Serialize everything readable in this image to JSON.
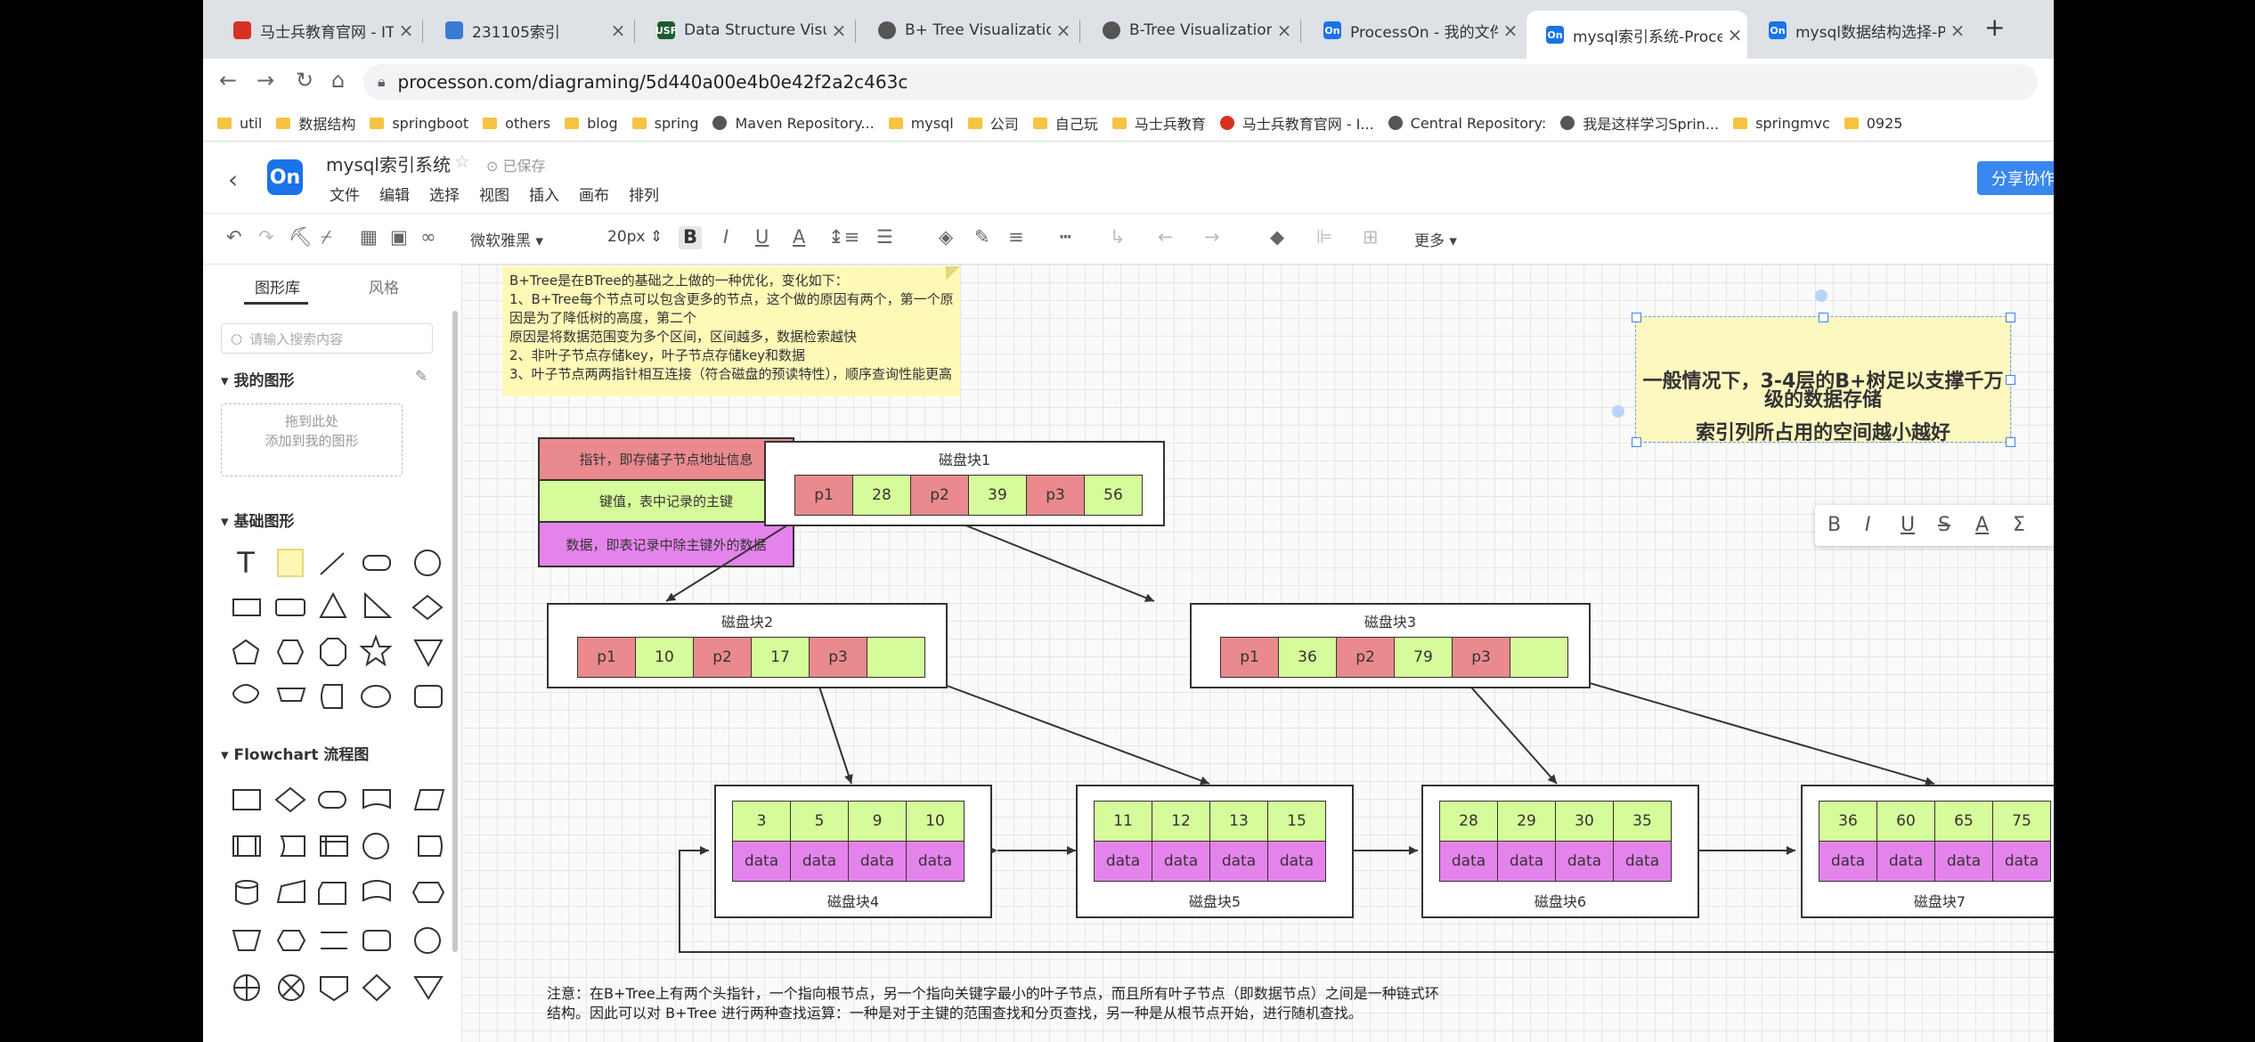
{
  "tabs": [
    {
      "title": "马士兵教育官网 - IT职",
      "icon": "msb-icon",
      "color": "#d93025"
    },
    {
      "title": "231105索引",
      "icon": "doc-icon",
      "color": "#3a7bd5"
    },
    {
      "title": "Data Structure Visual",
      "icon": "usf-icon",
      "color": "#1e5b2e"
    },
    {
      "title": "B+ Tree Visualization",
      "icon": "globe-icon",
      "color": "#555"
    },
    {
      "title": "B-Tree Visualization",
      "icon": "globe-icon",
      "color": "#555"
    },
    {
      "title": "ProcessOn - 我的文件",
      "icon": "processon-icon",
      "color": "#1a73e8"
    },
    {
      "title": "mysql索引系统-Proce",
      "icon": "processon-icon",
      "color": "#1a73e8",
      "active": true
    },
    {
      "title": "mysql数据结构选择-P",
      "icon": "processon-icon",
      "color": "#1a73e8"
    }
  ],
  "url": "processon.com/diagraming/5d440a00e4b0e42f2a2c463c",
  "bookmarks": [
    {
      "label": "util",
      "type": "folder"
    },
    {
      "label": "数据结构",
      "type": "folder"
    },
    {
      "label": "springboot",
      "type": "folder"
    },
    {
      "label": "others",
      "type": "folder"
    },
    {
      "label": "blog",
      "type": "folder"
    },
    {
      "label": "spring",
      "type": "folder"
    },
    {
      "label": "Maven Repository...",
      "type": "site"
    },
    {
      "label": "mysql",
      "type": "folder"
    },
    {
      "label": "公司",
      "type": "folder"
    },
    {
      "label": "自己玩",
      "type": "folder"
    },
    {
      "label": "马士兵教育",
      "type": "folder"
    },
    {
      "label": "马士兵教育官网 - I...",
      "type": "red"
    },
    {
      "label": "Central Repository:",
      "type": "site"
    },
    {
      "label": "我是这样学习Sprin...",
      "type": "site"
    },
    {
      "label": "springmvc",
      "type": "folder"
    },
    {
      "label": "0925",
      "type": "folder"
    }
  ],
  "app": {
    "logo": "On",
    "doc_title": "mysql索引系统",
    "saved": "已保存",
    "menu": [
      "文件",
      "编辑",
      "选择",
      "视图",
      "插入",
      "画布",
      "排列"
    ],
    "share": "分享协作"
  },
  "toolbar": {
    "font": "微软雅黑",
    "size": "20px",
    "more": "更多"
  },
  "sidebar": {
    "tab_library": "图形库",
    "tab_style": "风格",
    "search_placeholder": "请输入搜索内容",
    "my_shapes": "我的图形",
    "drop_line1": "拖到此处",
    "drop_line2": "添加到我的图形",
    "basic_shapes": "基础图形",
    "flowchart": "Flowchart 流程图"
  },
  "canvas": {
    "note_lines": [
      "B+Tree是在BTree的基础之上做的一种优化，变化如下：",
      "1、B+Tree每个节点可以包含更多的节点，这个做的原因有两个，第一个原因是为了降低树的高度，第二个",
      "原因是将数据范围变为多个区间，区间越多，数据检索越快",
      "2、非叶子节点存储key，叶子节点存储key和数据",
      "3、叶子节点两两指针相互连接（符合磁盘的预读特性），顺序查询性能更高"
    ],
    "legend": [
      {
        "text": "指针，即存储子节点地址信息",
        "color": "#ea8a8e"
      },
      {
        "text": "键值，表中记录的主键",
        "color": "#d6fb9a"
      },
      {
        "text": "数据，即表记录中除主键外的数据",
        "color": "#e583ec"
      }
    ],
    "callout_line1": "一般情况下，3-4层的B+树足以支撑千万级的数据存储",
    "callout_line2": "索引列所占用的空间越小越好",
    "block1": {
      "label": "磁盘块1",
      "cells": [
        "p1",
        "28",
        "p2",
        "39",
        "p3",
        "56"
      ]
    },
    "block2": {
      "label": "磁盘块2",
      "cells": [
        "p1",
        "10",
        "p2",
        "17",
        "p3",
        ""
      ]
    },
    "block3": {
      "label": "磁盘块3",
      "cells": [
        "p1",
        "36",
        "p2",
        "79",
        "p3",
        ""
      ]
    },
    "leaves": [
      {
        "label": "磁盘块4",
        "keys": [
          "3",
          "5",
          "9",
          "10"
        ],
        "data": [
          "data",
          "data",
          "data",
          "data"
        ]
      },
      {
        "label": "磁盘块5",
        "keys": [
          "11",
          "12",
          "13",
          "15"
        ],
        "data": [
          "data",
          "data",
          "data",
          "data"
        ]
      },
      {
        "label": "磁盘块6",
        "keys": [
          "28",
          "29",
          "30",
          "35"
        ],
        "data": [
          "data",
          "data",
          "data",
          "data"
        ]
      },
      {
        "label": "磁盘块7",
        "keys": [
          "36",
          "60",
          "65",
          "75"
        ],
        "data": [
          "data",
          "data",
          "data",
          "data"
        ]
      }
    ],
    "footnote_line1": "注意：在B+Tree上有两个头指针，一个指向根节点，另一个指向关键字最小的叶子节点，而且所有叶子节点（即数据节点）之间是一种链式环",
    "footnote_line2": "结构。因此可以对 B+Tree 进行两种查找运算：一种是对于主键的范围查找和分页查找，另一种是从根节点开始，进行随机查找。"
  }
}
